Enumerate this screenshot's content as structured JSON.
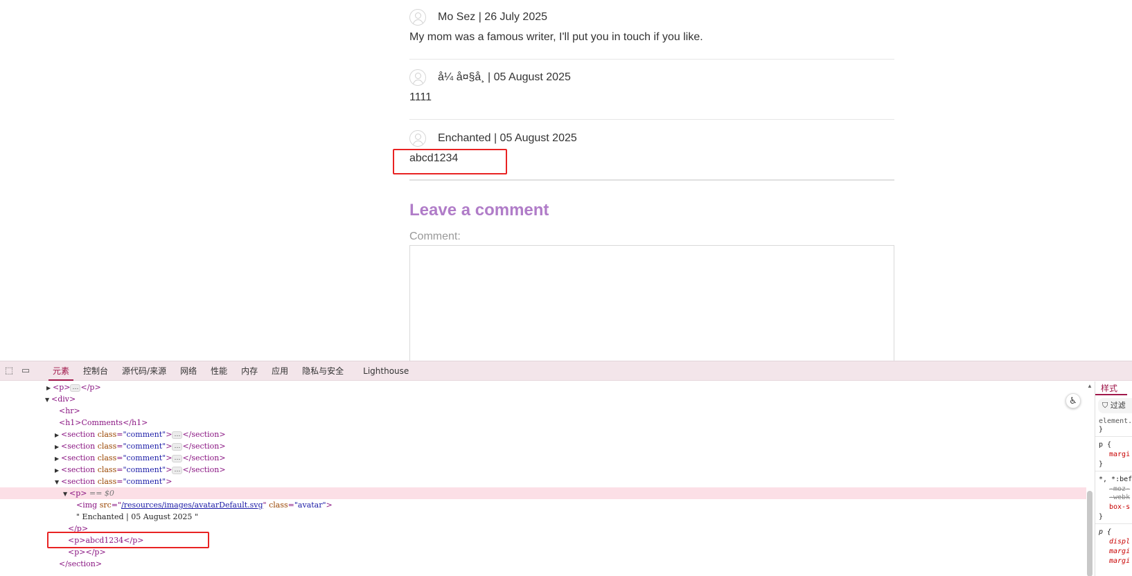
{
  "comments": [
    {
      "author": "Mo Sez | 26 July 2025",
      "text": "My mom was a famous writer, I'll put you in touch if you like."
    },
    {
      "author": "å¼ å¤§å¸ | 05 August 2025",
      "text": "1111"
    },
    {
      "author": "Enchanted | 05 August 2025",
      "text": "abcd1234"
    }
  ],
  "leave_comment": {
    "title": "Leave a comment",
    "label": "Comment:",
    "value": ""
  },
  "devtools": {
    "tabs": [
      "元素",
      "控制台",
      "源代码/来源",
      "网络",
      "性能",
      "内存",
      "应用",
      "隐私与安全",
      "Lighthouse"
    ],
    "active_tab": "元素",
    "dom": {
      "p_collapsed_open": "<p>",
      "p_collapsed_close": "</p>",
      "div_open": "<div>",
      "hr": "<hr>",
      "h1": "<h1>Comments</h1>",
      "section_open": "<section",
      "section_class_attr": "class",
      "section_class_val": "\"comment\"",
      "section_close_tag": ">",
      "section_end": "</section>",
      "p_open": "<p>",
      "selected_marker": "== $0",
      "img_open": "<img",
      "src_attr": "src",
      "src_val": "/resources/images/avatarDefault.svg",
      "class_attr": "class",
      "class_val": "\"avatar\"",
      "img_close": ">",
      "text_node": "\" Enchanted | 05 August 2025 \"",
      "p_close": "</p>",
      "p_abcd": "<p>abcd1234</p>",
      "p_empty": "<p></p>",
      "section_close": "</section>"
    },
    "styles": {
      "tab": "样式",
      "filter": "过滤",
      "lines": [
        "element.",
        "}",
        "p {",
        "margi",
        "}",
        "*, *:bef",
        "-moz-",
        "-webk",
        "box-s",
        "}",
        "p {",
        "displ",
        "margi",
        "margi"
      ]
    }
  }
}
